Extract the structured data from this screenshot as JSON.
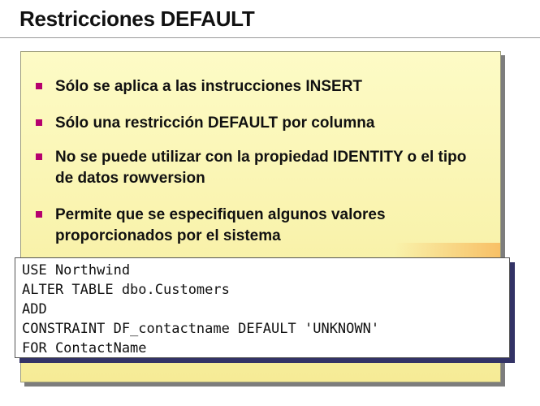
{
  "title": "Restricciones DEFAULT",
  "bullets": [
    "Sólo se aplica a las instrucciones INSERT",
    "Sólo una restricción DEFAULT por columna",
    "No se puede utilizar con la propiedad IDENTITY o el tipo de datos rowversion",
    "Permite que se especifiquen algunos valores proporcionados por el sistema"
  ],
  "code_lines": [
    "USE Northwind",
    "ALTER TABLE dbo.Customers",
    "ADD",
    "CONSTRAINT DF_contactname DEFAULT 'UNKNOWN'",
    "FOR ContactName"
  ],
  "colors": {
    "bullet": "#b5006e",
    "panel": "#f9f3ad",
    "code_shadow": "#333366"
  }
}
